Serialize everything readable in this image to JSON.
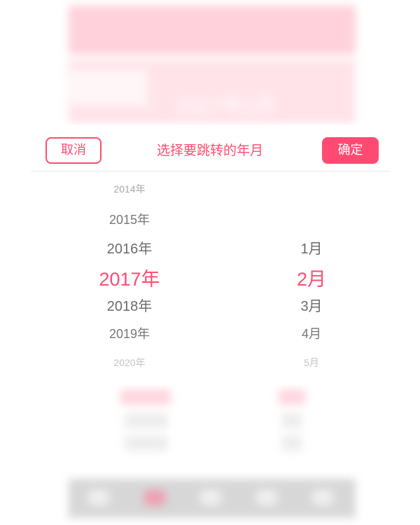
{
  "background": {
    "month_label": "2017年1月",
    "prev_icon": "chevron-left-icon",
    "next_icon": "chevron-right-icon",
    "accent_color": "#ff8fa8"
  },
  "picker": {
    "cancel_label": "取消",
    "title": "选择要跳转的年月",
    "confirm_label": "确定",
    "accent_color": "#ff4b72",
    "years": [
      "2014年",
      "2015年",
      "2016年",
      "2017年",
      "2018年",
      "2019年",
      "2020年"
    ],
    "selected_year": "2017年",
    "months": [
      "1月",
      "2月",
      "3月",
      "4月",
      "5月"
    ],
    "selected_month": "2月"
  }
}
